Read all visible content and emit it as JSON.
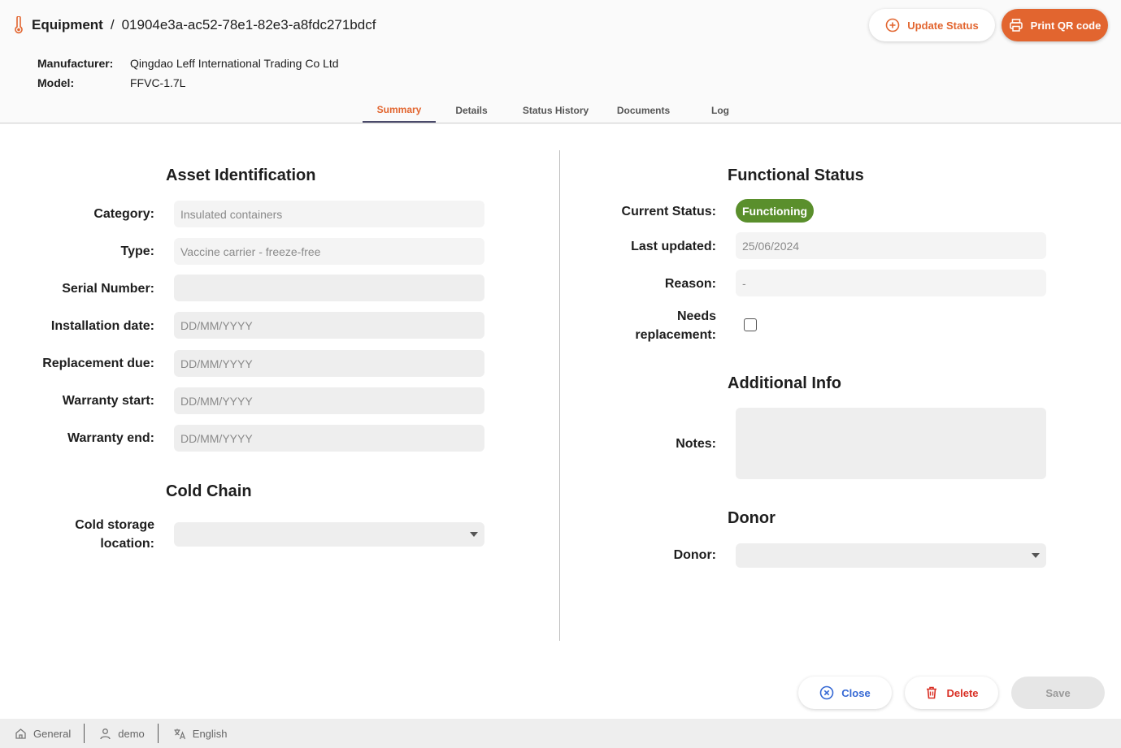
{
  "header": {
    "section": "Equipment",
    "separator": "/",
    "asset_id": "01904e3a-ac52-78e1-82e3-a8fdc271bdcf",
    "manufacturer_label": "Manufacturer:",
    "manufacturer_value": "Qingdao Leff International Trading Co Ltd",
    "model_label": "Model:",
    "model_value": "FFVC-1.7L",
    "update_status_label": "Update Status",
    "print_qr_label": "Print QR code",
    "icon": "thermometer-icon"
  },
  "tabs": [
    {
      "label": "Summary",
      "active": true
    },
    {
      "label": "Details",
      "active": false
    },
    {
      "label": "Status History",
      "active": false
    },
    {
      "label": "Documents",
      "active": false
    },
    {
      "label": "Log",
      "active": false
    }
  ],
  "asset_identification": {
    "title": "Asset Identification",
    "category_label": "Category:",
    "category_value": "Insulated containers",
    "type_label": "Type:",
    "type_value": "Vaccine carrier - freeze-free",
    "serial_label": "Serial Number:",
    "serial_value": "",
    "installation_label": "Installation date:",
    "installation_placeholder": "DD/MM/YYYY",
    "replacement_label": "Replacement due:",
    "replacement_placeholder": "DD/MM/YYYY",
    "warranty_start_label": "Warranty start:",
    "warranty_start_placeholder": "DD/MM/YYYY",
    "warranty_end_label": "Warranty end:",
    "warranty_end_placeholder": "DD/MM/YYYY"
  },
  "cold_chain": {
    "title": "Cold Chain",
    "location_label_line1": "Cold storage",
    "location_label_line2": "location:",
    "location_value": ""
  },
  "functional_status": {
    "title": "Functional Status",
    "current_label": "Current Status:",
    "current_value": "Functioning",
    "current_color": "#5a8f2c",
    "last_updated_label": "Last updated:",
    "last_updated_value": "25/06/2024",
    "reason_label": "Reason:",
    "reason_value": "-",
    "needs_label_line1": "Needs",
    "needs_label_line2": "replacement:",
    "needs_checked": false
  },
  "additional_info": {
    "title": "Additional Info",
    "notes_label": "Notes:",
    "notes_value": ""
  },
  "donor": {
    "title": "Donor",
    "donor_label": "Donor:",
    "donor_value": ""
  },
  "actions": {
    "close_label": "Close",
    "delete_label": "Delete",
    "save_label": "Save"
  },
  "statusbar": {
    "store": "General",
    "user": "demo",
    "language": "English"
  },
  "colors": {
    "accent": "#e2652f",
    "close": "#3568d4",
    "delete": "#d93025"
  }
}
